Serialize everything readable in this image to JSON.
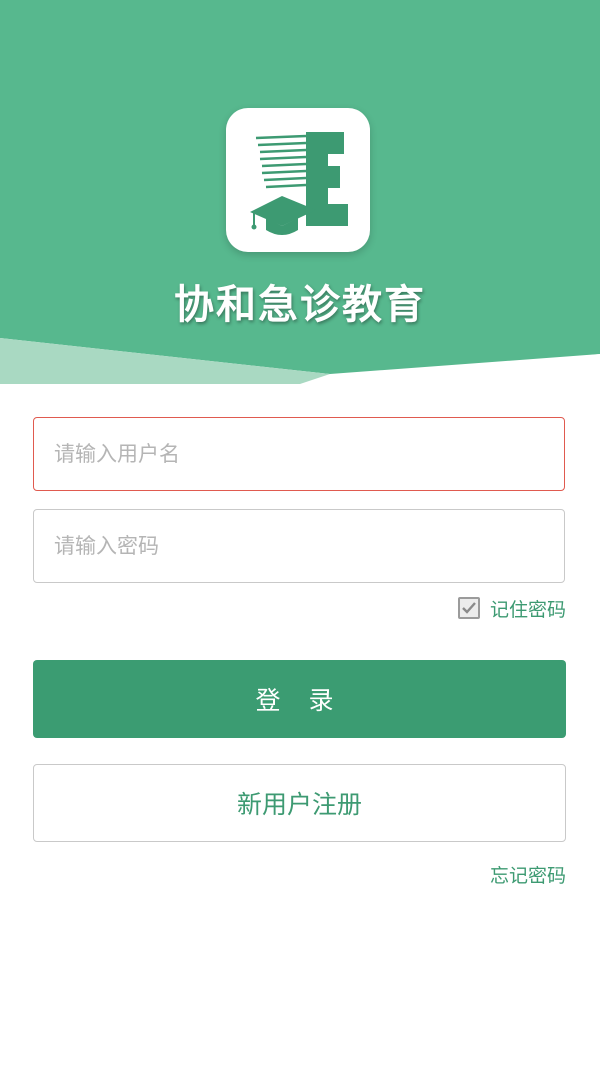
{
  "header": {
    "app_title": "协和急诊教育",
    "colors": {
      "primary": "#57b88e",
      "light": "#a9d9c2"
    },
    "logo_icon": "graduation-cap-E-logo"
  },
  "login_form": {
    "username": {
      "placeholder": "请输入用户名",
      "value": ""
    },
    "password": {
      "placeholder": "请输入密码",
      "value": ""
    },
    "remember_label": "记住密码",
    "remember_checked": true,
    "login_label": "登 录",
    "register_label": "新用户注册",
    "forgot_label": "忘记密码"
  },
  "colors": {
    "button": "#3b9c72",
    "link": "#3d9a72",
    "error_border": "#e05a4f"
  }
}
